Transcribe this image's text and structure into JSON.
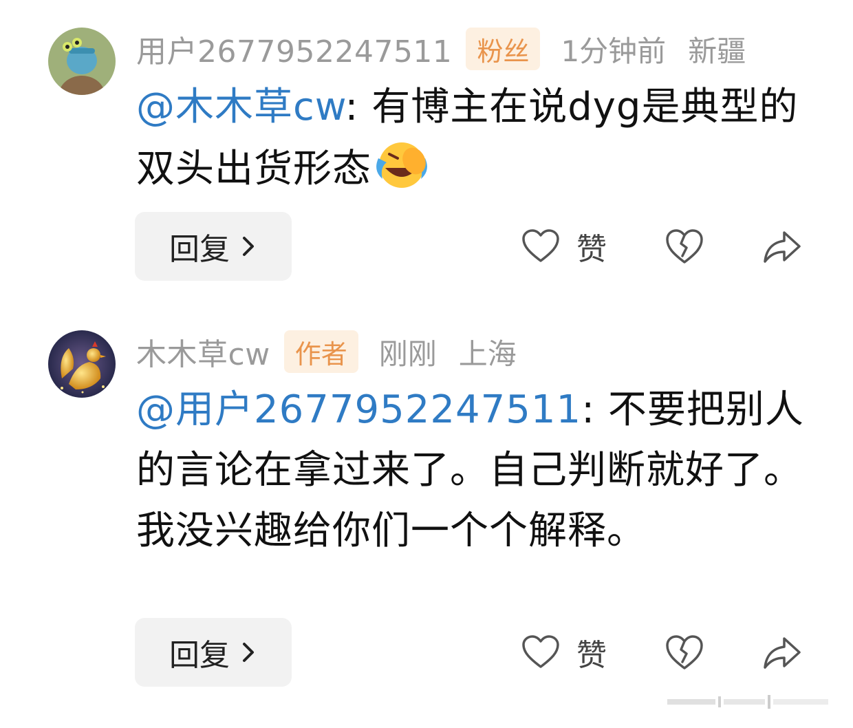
{
  "comments": [
    {
      "username": "用户2677952247511",
      "badge": "粉丝",
      "time": "1分钟前",
      "location": "新疆",
      "mention": "@木木草cw",
      "separator": ": ",
      "text": "有博主在说dyg是典型的双头出货形态",
      "emoji": "rolling-on-floor-laughing-icon",
      "reply_label": "回复",
      "like_label": "赞"
    },
    {
      "username": "木木草cw",
      "badge": "作者",
      "time": "刚刚",
      "location": "上海",
      "mention": "@用户2677952247511",
      "separator": ": ",
      "text": "不要把别人的言论在拿过来了。自己判断就好了。\n我没兴趣给你们一个个解释。",
      "reply_label": "回复",
      "like_label": "赞"
    }
  ],
  "colors": {
    "mention": "#2f7bc4",
    "meta": "#9a9a9a",
    "badge_bg": "#fdf0e1",
    "badge_text": "#e9944c",
    "reply_bg": "#f2f2f2"
  }
}
